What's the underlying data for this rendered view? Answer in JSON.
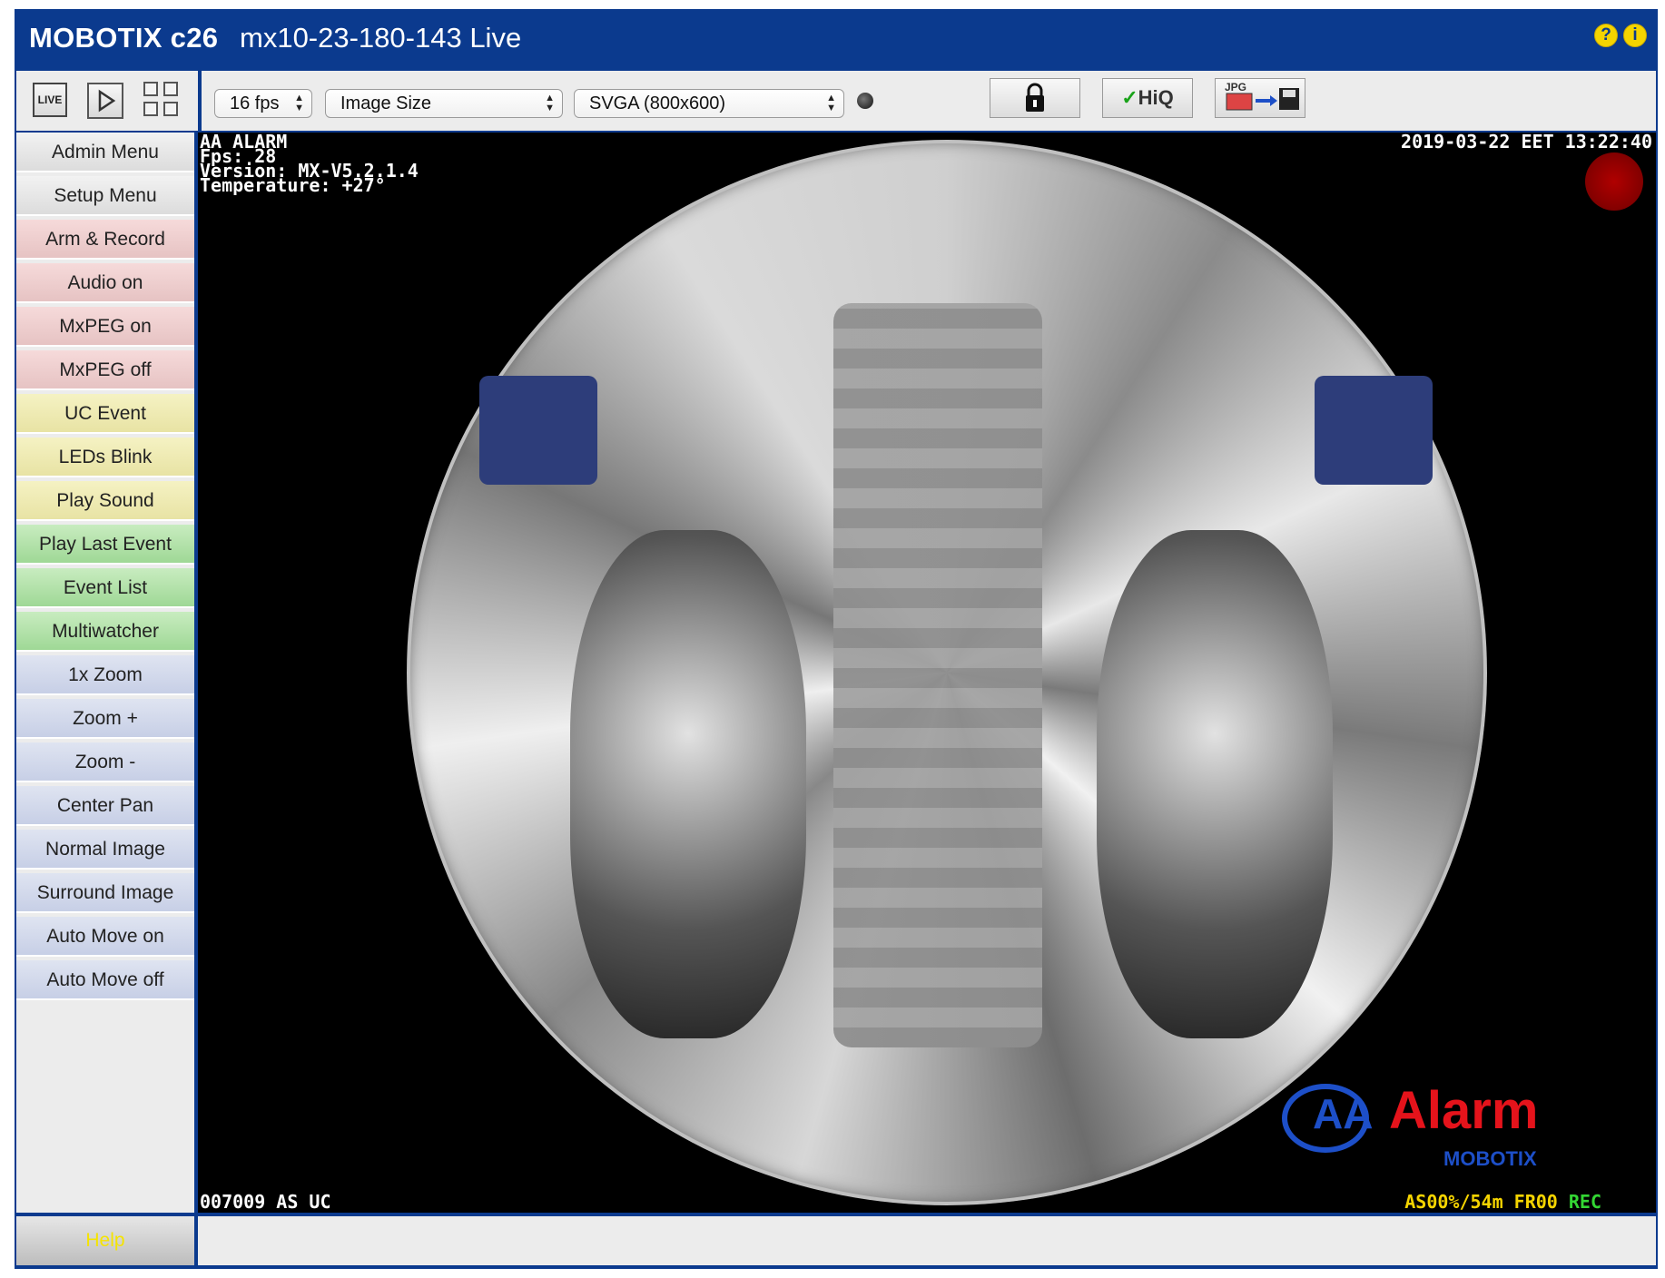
{
  "header": {
    "brand": "MOBOTIX c26",
    "camera": "mx10-23-180-143 Live",
    "help_icon": "?",
    "info_icon": "i"
  },
  "toolbar": {
    "live_label": "LIVE",
    "fps": "16 fps",
    "image_size": "Image Size",
    "resolution": "SVGA (800x600)",
    "hiq_label": "HiQ",
    "jpg_label": "JPG"
  },
  "sidebar": {
    "items": [
      {
        "label": "Admin Menu",
        "color": "grey"
      },
      {
        "label": "Setup Menu",
        "color": "grey"
      },
      {
        "label": "Arm & Record",
        "color": "red"
      },
      {
        "label": "Audio on",
        "color": "red"
      },
      {
        "label": "MxPEG on",
        "color": "red"
      },
      {
        "label": "MxPEG off",
        "color": "red"
      },
      {
        "label": "UC Event",
        "color": "yellow"
      },
      {
        "label": "LEDs Blink",
        "color": "yellow"
      },
      {
        "label": "Play Sound",
        "color": "yellow"
      },
      {
        "label": "Play Last Event",
        "color": "green"
      },
      {
        "label": "Event List",
        "color": "green"
      },
      {
        "label": "Multiwatcher",
        "color": "green"
      },
      {
        "label": "1x Zoom",
        "color": "blue"
      },
      {
        "label": "Zoom +",
        "color": "blue"
      },
      {
        "label": "Zoom -",
        "color": "blue"
      },
      {
        "label": "Center Pan",
        "color": "blue"
      },
      {
        "label": "Normal Image",
        "color": "blue"
      },
      {
        "label": "Surround Image",
        "color": "blue"
      },
      {
        "label": "Auto Move on",
        "color": "blue"
      },
      {
        "label": "Auto Move off",
        "color": "blue"
      }
    ],
    "help_label": "Help"
  },
  "video": {
    "osd_top_left": "AA ALARM\nFps: 28\nVersion: MX-V5.2.1.4\nTemperature: +27°",
    "osd_top_right": "2019-03-22 EET 13:22:40",
    "osd_bottom_left": "007009 AS UC",
    "osd_bottom_right": "AS00%/54m FR00 ",
    "osd_rec": "REC",
    "logo_word": "Alarm",
    "logo_mark": "AA",
    "logo_sub": "MOBOTIX"
  },
  "colors": {
    "frame_blue": "#0b3a8e",
    "rec_red": "#b00000",
    "osd_yellow": "#f5d400",
    "osd_green": "#33d633"
  }
}
